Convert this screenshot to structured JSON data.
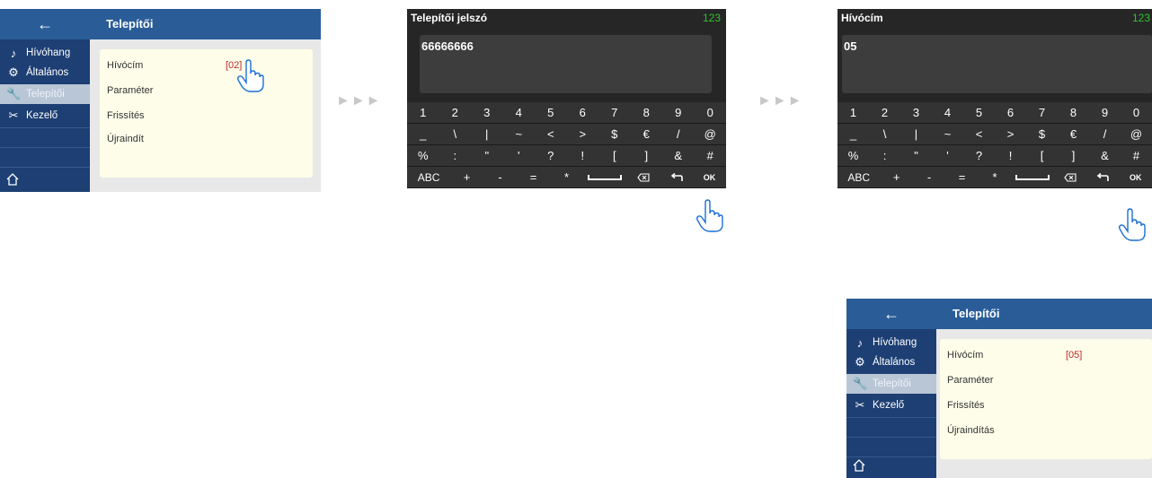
{
  "settings_screens": [
    {
      "back_icon": "arrow-left-icon",
      "title": "Telepítői",
      "sidebar": [
        {
          "icon": "music-note-icon",
          "label": "Hívóhang",
          "active": false
        },
        {
          "icon": "gear-icon",
          "label": "Általános",
          "active": false
        },
        {
          "icon": "wrench-icon",
          "label": "Telepítői",
          "active": true
        },
        {
          "icon": "tools-icon",
          "label": "Kezelő",
          "active": false
        }
      ],
      "home_icon": "home-icon",
      "rows": [
        {
          "label": "Hívócím",
          "value": "[02]"
        },
        {
          "label": "Paraméter",
          "value": ""
        },
        {
          "label": "Frissítés",
          "value": ""
        },
        {
          "label": "Újraindít",
          "value": ""
        }
      ]
    },
    {
      "back_icon": "arrow-left-icon",
      "title": "Telepítői",
      "sidebar": [
        {
          "icon": "music-note-icon",
          "label": "Hívóhang",
          "active": false
        },
        {
          "icon": "gear-icon",
          "label": "Általános",
          "active": false
        },
        {
          "icon": "wrench-icon",
          "label": "Telepítői",
          "active": true
        },
        {
          "icon": "tools-icon",
          "label": "Kezelő",
          "active": false
        }
      ],
      "home_icon": "home-icon",
      "rows": [
        {
          "label": "Hívócím",
          "value": "[05]"
        },
        {
          "label": "Paraméter",
          "value": ""
        },
        {
          "label": "Frissítés",
          "value": ""
        },
        {
          "label": "Újraindítás",
          "value": ""
        }
      ]
    }
  ],
  "keypad_screens": [
    {
      "title": "Telepítői jelszó",
      "mode": "123",
      "entry": "66666666"
    },
    {
      "title": "Hívócím",
      "mode": "123",
      "entry": "05"
    }
  ],
  "keyboard": {
    "row1": [
      "1",
      "2",
      "3",
      "4",
      "5",
      "6",
      "7",
      "8",
      "9",
      "0"
    ],
    "row2": [
      "_",
      "\\",
      "|",
      "~",
      "<",
      ">",
      "$",
      "€",
      "/",
      "@"
    ],
    "row3": [
      "%",
      ":",
      "\"",
      "'",
      "?",
      "!",
      "[",
      "]",
      "&",
      "#"
    ],
    "row4": [
      "ABC",
      "+",
      "-",
      "=",
      "*",
      "space-bar-icon",
      "backspace-icon",
      "return-arrow-icon",
      "OK"
    ]
  },
  "arrows": "►►►",
  "hand_icon": "pointing-hand-icon",
  "colors": {
    "sidebar": "#1d3f73",
    "topbar": "#2a5d98",
    "panel": "#fdfde9",
    "value_red": "#c0262c",
    "mode_green": "#2fc22f",
    "keypad_bg": "#262626"
  }
}
